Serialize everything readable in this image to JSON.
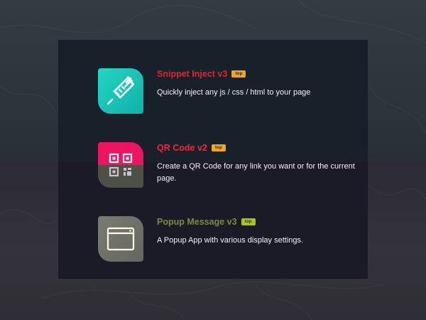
{
  "apps": [
    {
      "title": "Snippet Inject v3",
      "badge": "top",
      "description": "Quickly inject any js / css / html to your page",
      "title_color": "#e8202a",
      "badge_color": "#f3a81a",
      "icon": "syringe-icon",
      "icon_bg": "#19c8b8"
    },
    {
      "title": "QR Code v2",
      "badge": "top",
      "description": "Create a QR Code for any link you want or for the current page.",
      "title_color": "#ff1f3c",
      "badge_color": "#f3a81a",
      "icon": "qr-code-icon",
      "icon_bg": "#f01460"
    },
    {
      "title": "Popup Message v3",
      "badge": "top",
      "description": "A Popup App with various display settings.",
      "title_color": "#7d8a3a",
      "badge_color": "#a8c61a",
      "icon": "window-icon",
      "icon_bg": "#6f7168"
    }
  ]
}
